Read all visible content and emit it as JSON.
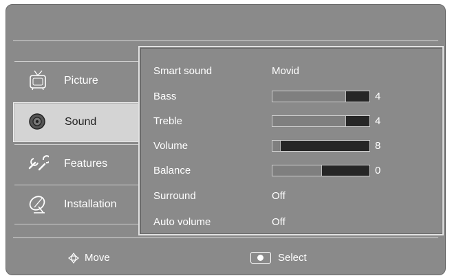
{
  "sidebar": {
    "items": [
      {
        "label": "Picture",
        "icon": "tv-icon"
      },
      {
        "label": "Sound",
        "icon": "speaker-icon"
      },
      {
        "label": "Features",
        "icon": "tools-icon"
      },
      {
        "label": "Installation",
        "icon": "satellite-dish-icon"
      }
    ],
    "active": "Sound"
  },
  "sound": {
    "smart_sound": {
      "label": "Smart sound",
      "value": "Movid"
    },
    "bass": {
      "label": "Bass",
      "value": "4",
      "level": 0.75
    },
    "treble": {
      "label": "Treble",
      "value": "4",
      "level": 0.75
    },
    "volume": {
      "label": "Volume",
      "value": "8",
      "level": 0.08
    },
    "balance": {
      "label": "Balance",
      "value": "0",
      "level": 0.5
    },
    "surround": {
      "label": "Surround",
      "value": "Off"
    },
    "auto_volume": {
      "label": "Auto volume",
      "value": "Off"
    }
  },
  "footer": {
    "move_label": "Move",
    "select_label": "Select"
  },
  "colors": {
    "panel_bg": "#8a8a8a",
    "active_tab_bg": "#d4d4d4",
    "bar_dark": "#262626",
    "bar_fill": "#7f7f7f"
  }
}
